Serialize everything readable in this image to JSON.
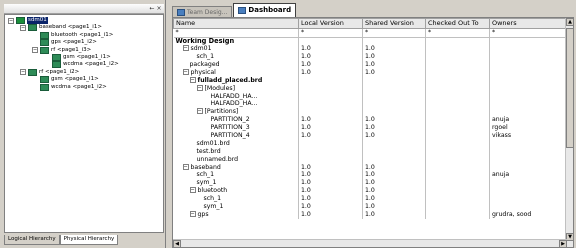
{
  "left_panel": {
    "controls": [
      "←",
      "×"
    ],
    "tree": [
      {
        "label": "sdm01",
        "expander": "−",
        "level": 0,
        "selected": true
      },
      {
        "label": "baseband <page1_i1>",
        "expander": "−",
        "level": 1
      },
      {
        "label": "bluetooth <page1_i1>",
        "expander": "",
        "level": 2
      },
      {
        "label": "gps <page1_i2>",
        "expander": "",
        "level": 2
      },
      {
        "label": "rf <page1_i3>",
        "expander": "−",
        "level": 2
      },
      {
        "label": "gsm <page1_i1>",
        "expander": "",
        "level": 3
      },
      {
        "label": "wcdma <page1_i2>",
        "expander": "",
        "level": 3
      },
      {
        "label": "rf <page1_i2>",
        "expander": "−",
        "level": 1
      },
      {
        "label": "gsm <page1_i1>",
        "expander": "",
        "level": 2
      },
      {
        "label": "wcdma <page1_i2>",
        "expander": "",
        "level": 2
      }
    ],
    "tabs": [
      "Logical Hierarchy",
      "Physical Hierarchy"
    ]
  },
  "right_panel": {
    "tabs": [
      {
        "label": "Team Desig...",
        "active": false
      },
      {
        "label": "Dashboard",
        "active": true
      }
    ],
    "columns": [
      "Name",
      "Local Version",
      "Shared Version",
      "Checked Out To",
      "Owners"
    ],
    "filter_row": [
      "*",
      "*",
      "*",
      "*",
      "*"
    ],
    "rows": [
      {
        "name": "Working Design",
        "indent": 0,
        "section": true,
        "local": "",
        "shared": "",
        "checked": "",
        "owners": ""
      },
      {
        "name": "sdm01",
        "indent": 1,
        "exp": "−",
        "local": "1.0",
        "shared": "1.0",
        "checked": "",
        "owners": ""
      },
      {
        "name": "sch_1",
        "indent": 3,
        "local": "1.0",
        "shared": "1.0",
        "checked": "",
        "owners": ""
      },
      {
        "name": "packaged",
        "indent": 2,
        "local": "1.0",
        "shared": "1.0",
        "checked": "",
        "owners": ""
      },
      {
        "name": "physical",
        "indent": 1,
        "exp": "−",
        "local": "1.0",
        "shared": "1.0",
        "checked": "",
        "owners": ""
      },
      {
        "name": "fulladd_placed.brd",
        "indent": 2,
        "exp": "−",
        "bold": true,
        "local": "",
        "shared": "",
        "checked": "",
        "owners": ""
      },
      {
        "name": "[Modules]",
        "indent": 3,
        "exp": "−",
        "local": "",
        "shared": "",
        "checked": "",
        "owners": ""
      },
      {
        "name": "HALFADD_HA...",
        "indent": 5,
        "local": "",
        "shared": "",
        "checked": "",
        "owners": ""
      },
      {
        "name": "HALFADD_HA...",
        "indent": 5,
        "local": "",
        "shared": "",
        "checked": "",
        "owners": ""
      },
      {
        "name": "[Partitions]",
        "indent": 3,
        "exp": "−",
        "local": "",
        "shared": "",
        "checked": "",
        "owners": ""
      },
      {
        "name": "PARTITION_2",
        "indent": 5,
        "local": "1.0",
        "shared": "1.0",
        "checked": "",
        "owners": "anuja"
      },
      {
        "name": "PARTITION_3",
        "indent": 5,
        "local": "1.0",
        "shared": "1.0",
        "checked": "",
        "owners": "rgoel"
      },
      {
        "name": "PARTITION_4",
        "indent": 5,
        "local": "1.0",
        "shared": "1.0",
        "checked": "",
        "owners": "vikass"
      },
      {
        "name": "sdm01.brd",
        "indent": 3,
        "local": "",
        "shared": "",
        "checked": "",
        "owners": ""
      },
      {
        "name": "test.brd",
        "indent": 3,
        "local": "",
        "shared": "",
        "checked": "",
        "owners": ""
      },
      {
        "name": "unnamed.brd",
        "indent": 3,
        "local": "",
        "shared": "",
        "checked": "",
        "owners": ""
      },
      {
        "name": "baseband",
        "indent": 1,
        "exp": "−",
        "local": "1.0",
        "shared": "1.0",
        "checked": "",
        "owners": ""
      },
      {
        "name": "sch_1",
        "indent": 3,
        "local": "1.0",
        "shared": "1.0",
        "checked": "",
        "owners": "anuja"
      },
      {
        "name": "sym_1",
        "indent": 3,
        "local": "1.0",
        "shared": "1.0",
        "checked": "",
        "owners": ""
      },
      {
        "name": "bluetooth",
        "indent": 2,
        "exp": "−",
        "local": "1.0",
        "shared": "1.0",
        "checked": "",
        "owners": ""
      },
      {
        "name": "sch_1",
        "indent": 4,
        "local": "1.0",
        "shared": "1.0",
        "checked": "",
        "owners": ""
      },
      {
        "name": "sym_1",
        "indent": 4,
        "local": "1.0",
        "shared": "1.0",
        "checked": "",
        "owners": ""
      },
      {
        "name": "gps",
        "indent": 2,
        "exp": "−",
        "local": "1.0",
        "shared": "1.0",
        "checked": "",
        "owners": "grudra, sood"
      }
    ],
    "scroll_up": "▲",
    "scroll_down": "▼",
    "scroll_left": "◀",
    "scroll_right": "▶"
  }
}
